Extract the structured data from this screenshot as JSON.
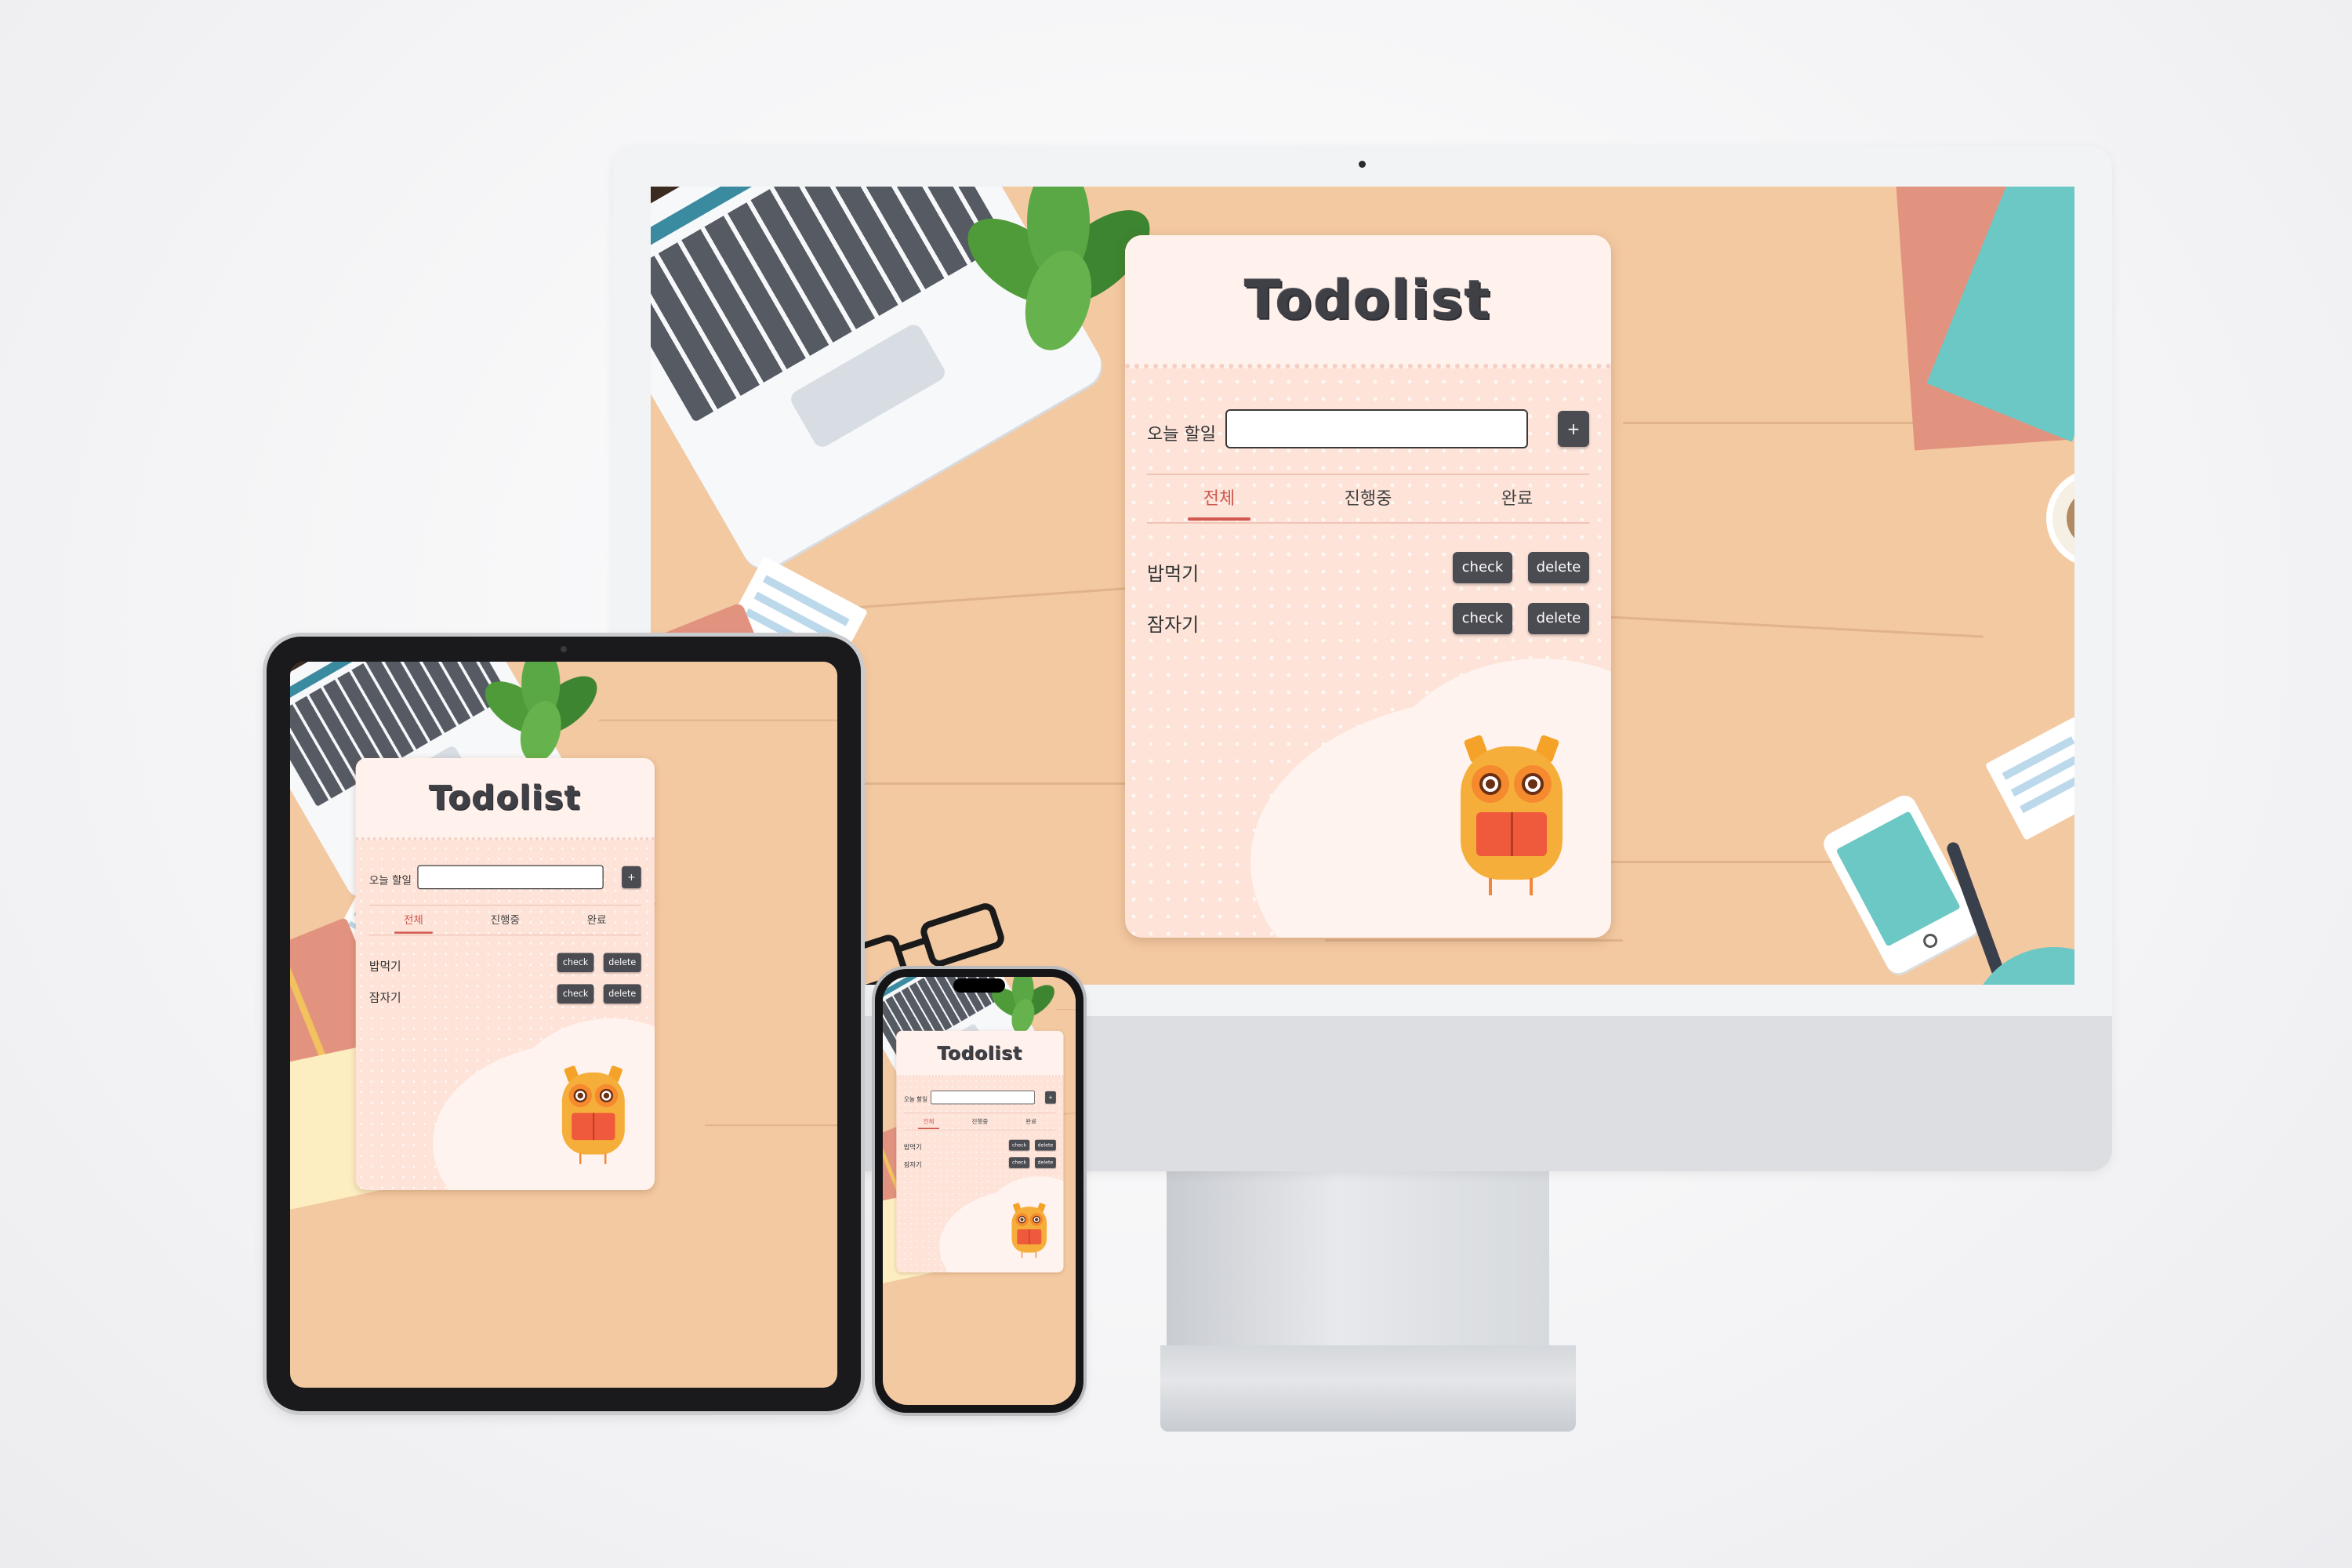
{
  "app": {
    "title": "Todolist",
    "input_label": "오늘 할일",
    "input_value": "",
    "input_placeholder": "",
    "add_button_label": "+",
    "tabs": [
      {
        "label": "전체",
        "active": true
      },
      {
        "label": "진행중",
        "active": false
      },
      {
        "label": "완료",
        "active": false
      }
    ],
    "tasks": [
      {
        "text": "밥먹기",
        "check_label": "check",
        "delete_label": "delete"
      },
      {
        "text": "잠자기",
        "check_label": "check",
        "delete_label": "delete"
      }
    ]
  },
  "colors": {
    "desk": "#f3c9a2",
    "card": "#fde3d8",
    "card_header": "#fff1ec",
    "button": "#4b4b52",
    "active_tab": "#d0584e",
    "title": "#3f3f46"
  },
  "icons": [
    "owl-icon",
    "laptop-icon",
    "plant-icon",
    "notebook-icon",
    "phone-icon",
    "pen-icon",
    "glasses-icon",
    "coffee-icon"
  ]
}
